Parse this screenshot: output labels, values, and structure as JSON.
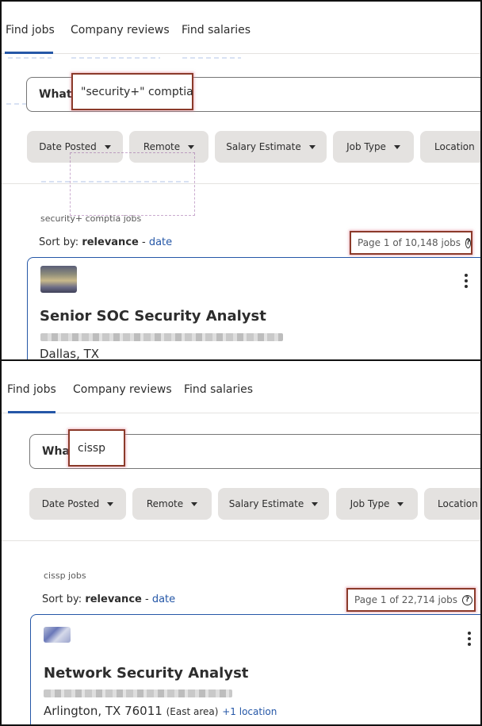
{
  "panels": [
    {
      "nav": {
        "tabs": [
          "Find jobs",
          "Company reviews",
          "Find salaries"
        ],
        "active": 0
      },
      "search": {
        "label": "What",
        "value": "\"security+\" comptia"
      },
      "filters": [
        "Date Posted",
        "Remote",
        "Salary Estimate",
        "Job Type",
        "Location"
      ],
      "results_label": "security+ comptia jobs",
      "sort": {
        "prefix": "Sort by:",
        "active": "relevance",
        "separator": "-",
        "alternate": "date"
      },
      "page_count": "Page 1 of 10,148 jobs",
      "job": {
        "title": "Senior SOC Security Analyst",
        "location": "Dallas, TX",
        "location_area": "",
        "location_more": ""
      }
    },
    {
      "nav": {
        "tabs": [
          "Find jobs",
          "Company reviews",
          "Find salaries"
        ],
        "active": 0
      },
      "search": {
        "label": "What",
        "value": "cissp"
      },
      "filters": [
        "Date Posted",
        "Remote",
        "Salary Estimate",
        "Job Type",
        "Location"
      ],
      "results_label": "cissp jobs",
      "sort": {
        "prefix": "Sort by:",
        "active": "relevance",
        "separator": "-",
        "alternate": "date"
      },
      "page_count": "Page 1 of 22,714 jobs",
      "job": {
        "title": "Network Security Analyst",
        "location": "Arlington, TX 76011",
        "location_area": "(East area)",
        "location_more": "+1 location"
      }
    }
  ],
  "icons": {
    "help": "question-circle-icon",
    "menu": "kebab-menu-icon",
    "caret": "caret-down-icon"
  },
  "colors": {
    "accent": "#2557a7",
    "chip_bg": "#e4e2e0",
    "highlight": "#8b3a2a"
  }
}
